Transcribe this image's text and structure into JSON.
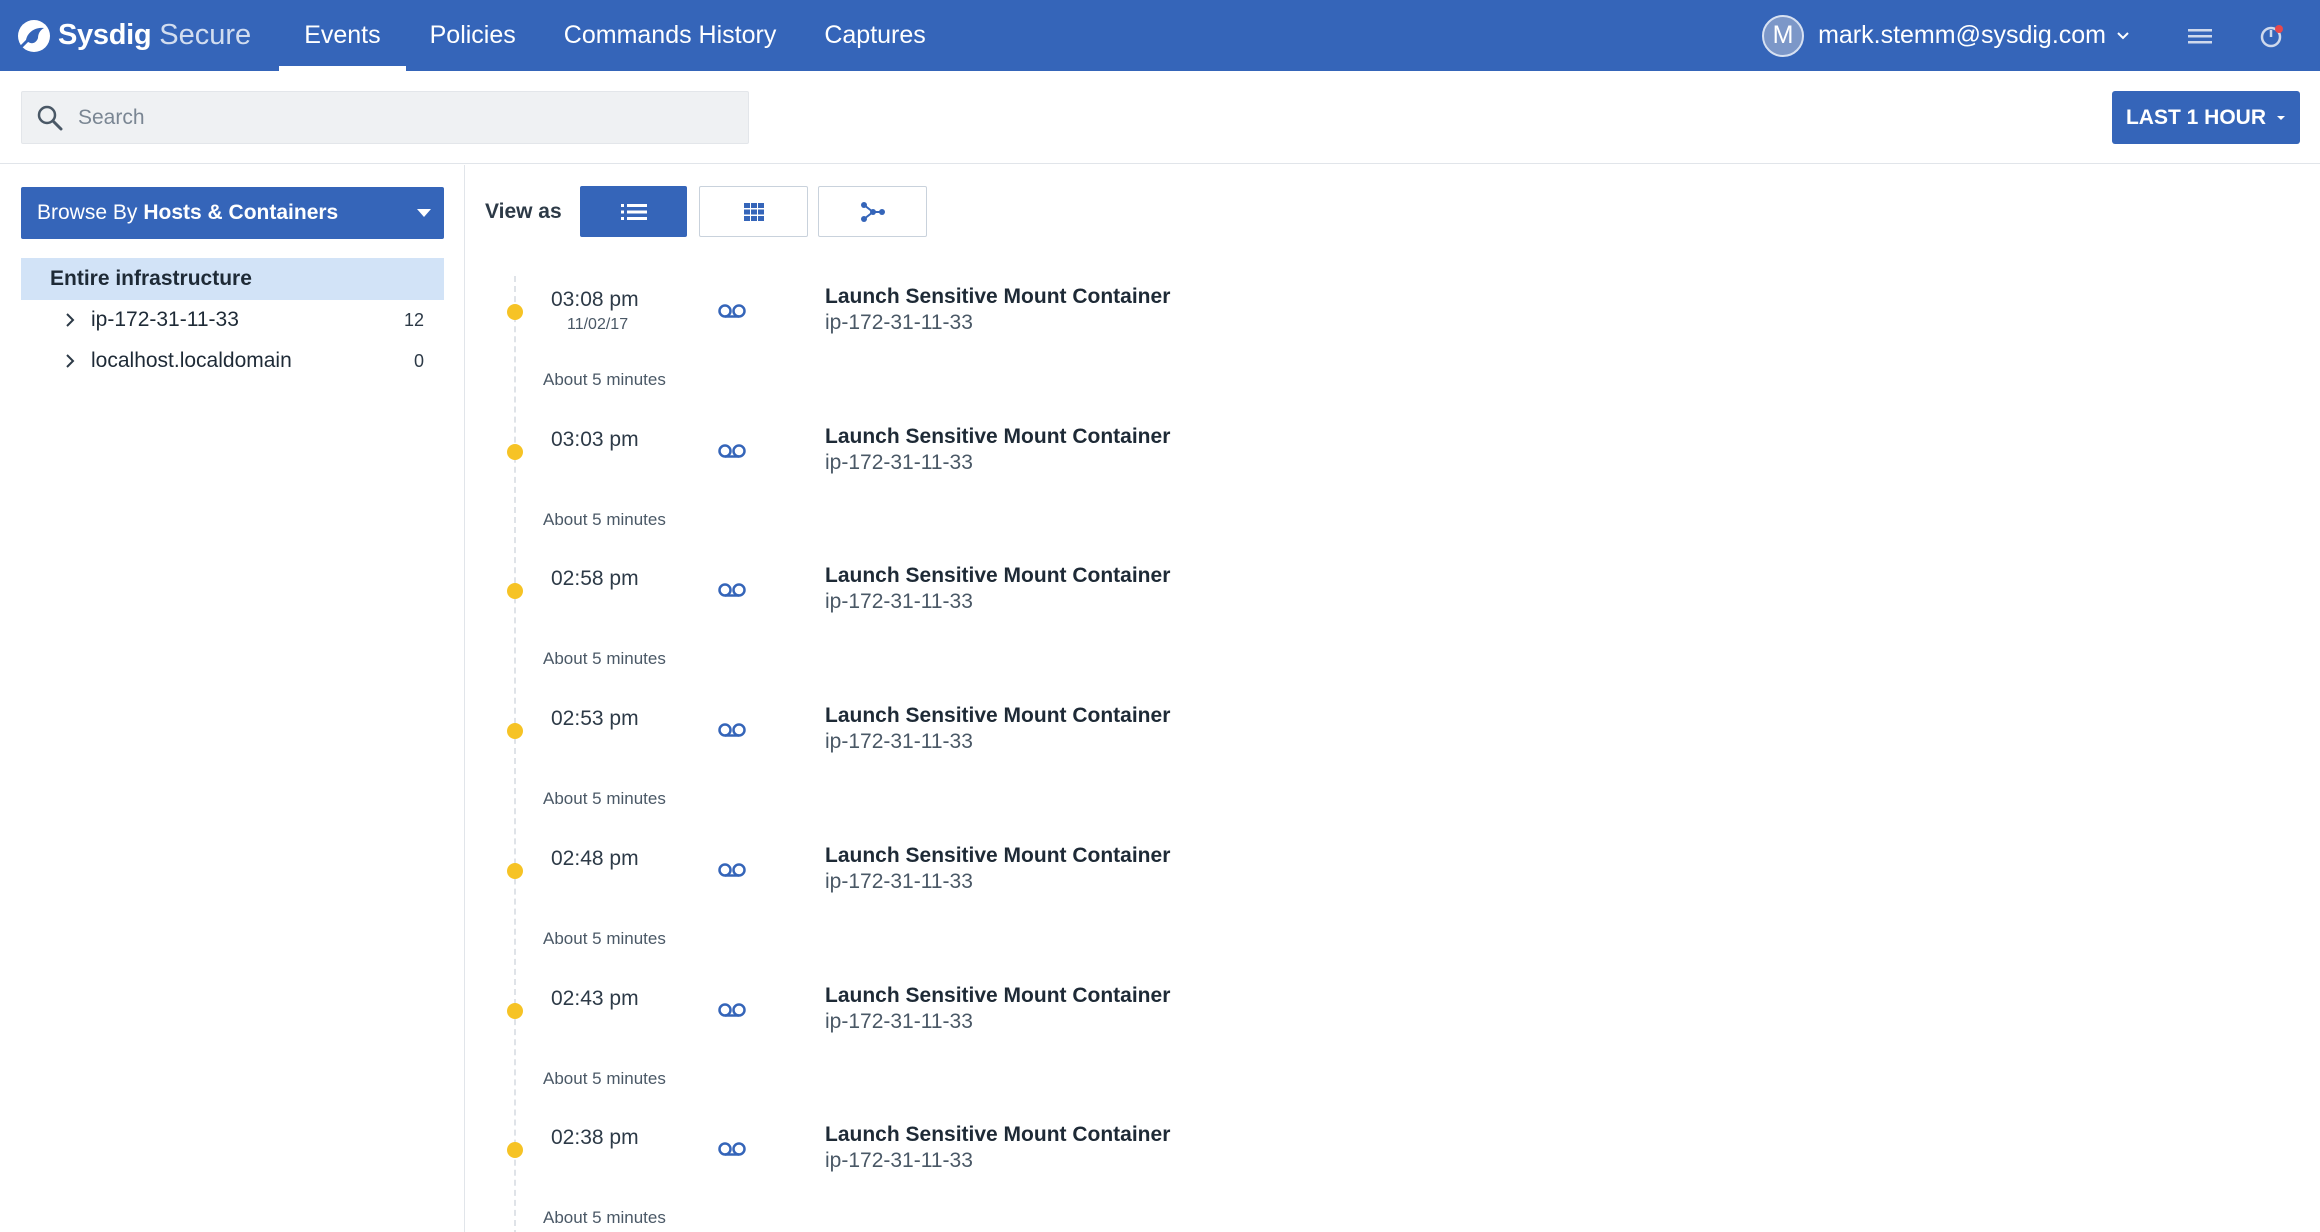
{
  "header": {
    "brand_name": "Sysdig",
    "brand_product": "Secure",
    "nav": [
      {
        "label": "Events",
        "active": true
      },
      {
        "label": "Policies",
        "active": false
      },
      {
        "label": "Commands History",
        "active": false
      },
      {
        "label": "Captures",
        "active": false
      }
    ],
    "avatar_initial": "M",
    "user_email": "mark.stemm@sysdig.com",
    "icons": [
      "sysdig-logo-icon",
      "chevron-down-icon",
      "menu-icon",
      "notification-icon"
    ]
  },
  "search": {
    "placeholder": "Search",
    "value": ""
  },
  "time_range": {
    "label": "LAST 1 HOUR"
  },
  "sidebar": {
    "browse_prefix": "Browse By",
    "browse_value": "Hosts & Containers",
    "root_label": "Entire infrastructure",
    "items": [
      {
        "label": "ip-172-31-11-33",
        "count": "12"
      },
      {
        "label": "localhost.localdomain",
        "count": "0"
      }
    ]
  },
  "view": {
    "label": "View as",
    "modes": [
      {
        "name": "list",
        "active": true
      },
      {
        "name": "grid",
        "active": false
      },
      {
        "name": "graph",
        "active": false
      }
    ]
  },
  "events": [
    {
      "time": "03:08 pm",
      "date": "11/02/17",
      "title": "Launch Sensitive Mount Container",
      "host": "ip-172-31-11-33",
      "gap": "About 5 minutes"
    },
    {
      "time": "03:03 pm",
      "date": "",
      "title": "Launch Sensitive Mount Container",
      "host": "ip-172-31-11-33",
      "gap": "About 5 minutes"
    },
    {
      "time": "02:58 pm",
      "date": "",
      "title": "Launch Sensitive Mount Container",
      "host": "ip-172-31-11-33",
      "gap": "About 5 minutes"
    },
    {
      "time": "02:53 pm",
      "date": "",
      "title": "Launch Sensitive Mount Container",
      "host": "ip-172-31-11-33",
      "gap": "About 5 minutes"
    },
    {
      "time": "02:48 pm",
      "date": "",
      "title": "Launch Sensitive Mount Container",
      "host": "ip-172-31-11-33",
      "gap": "About 5 minutes"
    },
    {
      "time": "02:43 pm",
      "date": "",
      "title": "Launch Sensitive Mount Container",
      "host": "ip-172-31-11-33",
      "gap": "About 5 minutes"
    },
    {
      "time": "02:38 pm",
      "date": "",
      "title": "Launch Sensitive Mount Container",
      "host": "ip-172-31-11-33",
      "gap": "About 5 minutes"
    }
  ],
  "colors": {
    "brand": "#3565b9",
    "selected_row": "#d2e3f7",
    "event_dot": "#f6c325"
  }
}
